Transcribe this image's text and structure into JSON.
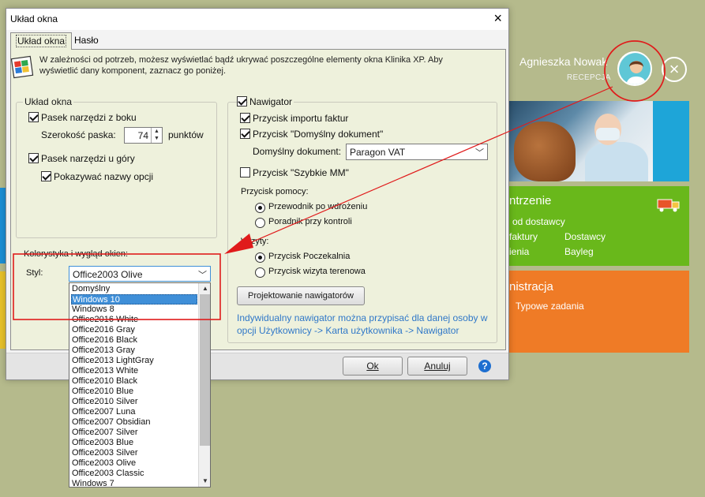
{
  "background": {
    "user": {
      "name": "Agnieszka Nowak",
      "role": "RECEPCJA"
    },
    "tiles": {
      "green": {
        "title": "ntrzenie",
        "lines": [
          "od dostawcy",
          "faktury",
          "Dostawcy",
          "ienia",
          "Bayleg"
        ]
      },
      "orange": {
        "title": "nistracja",
        "lines": [
          "Typowe zadania"
        ]
      }
    },
    "icons": {
      "close": "×"
    }
  },
  "dialog": {
    "title": "Układ okna",
    "tabs": [
      "Układ okna",
      "Hasło"
    ],
    "info": "W zależności od potrzeb, możesz wyświetlać bądź ukrywać poszczególne elementy okna Klinika XP. Aby wyświetlić dany komponent, zaznacz go poniżej.",
    "layout_group": {
      "title": "Układ okna",
      "side_toolbar": {
        "label": "Pasek narzędzi z boku",
        "checked": true
      },
      "strip_width_label": "Szerokość paska:",
      "strip_width_value": "74",
      "strip_width_unit": "punktów",
      "top_toolbar": {
        "label": "Pasek narzędzi u góry",
        "checked": true
      },
      "show_names": {
        "label": "Pokazywać nazwy opcji",
        "checked": true
      }
    },
    "navigator_group": {
      "title": "Nawigator",
      "checked": true,
      "import_button": {
        "label": "Przycisk importu faktur",
        "checked": true
      },
      "default_doc_button": {
        "label": "Przycisk \"Domyślny dokument\"",
        "checked": true
      },
      "default_doc_label": "Domyślny dokument:",
      "default_doc_value": "Paragon VAT",
      "quick_mm_button": {
        "label": "Przycisk \"Szybkie MM\"",
        "checked": false
      },
      "help_title": "Przycisk pomocy:",
      "help_options": [
        {
          "label": "Przewodnik po wdrożeniu",
          "selected": true
        },
        {
          "label": "Poradnik przy kontroli",
          "selected": false
        }
      ],
      "visits_title": "Wizyty:",
      "visit_options": [
        {
          "label": "Przycisk Poczekalnia",
          "selected": true
        },
        {
          "label": "Przycisk wizyta terenowa",
          "selected": false
        }
      ],
      "design_button": "Projektowanie nawigatorów",
      "hint": "Indywidualny nawigator można przypisać dla danej osoby w opcji Użytkownicy -> Karta użytkownika -> Nawigator"
    },
    "color_group": {
      "title": "Kolorystyka i wygląd okien:",
      "style_label": "Styl:",
      "style_value": "Office2003 Olive",
      "options": [
        "Domyślny",
        "Windows 10",
        "Windows 8",
        "Office2016 White",
        "Office2016 Gray",
        "Office2016 Black",
        "Office2013 Gray",
        "Office2013 LightGray",
        "Office2013 White",
        "Office2010 Black",
        "Office2010 Blue",
        "Office2010 Silver",
        "Office2007 Luna",
        "Office2007 Obsidian",
        "Office2007 Silver",
        "Office2003 Blue",
        "Office2003 Silver",
        "Office2003 Olive",
        "Office2003 Classic",
        "Windows 7"
      ],
      "highlighted_option": "Windows 10"
    },
    "footer": {
      "ok_label": "Ok",
      "cancel_label": "Anuluj",
      "help_label": "?"
    }
  },
  "colors": {
    "background": "#b5ba8c",
    "panel": "#eef1dc",
    "annotation_red": "#e01b1b",
    "highlight": "#3f8fd8",
    "link": "#3078c8"
  }
}
